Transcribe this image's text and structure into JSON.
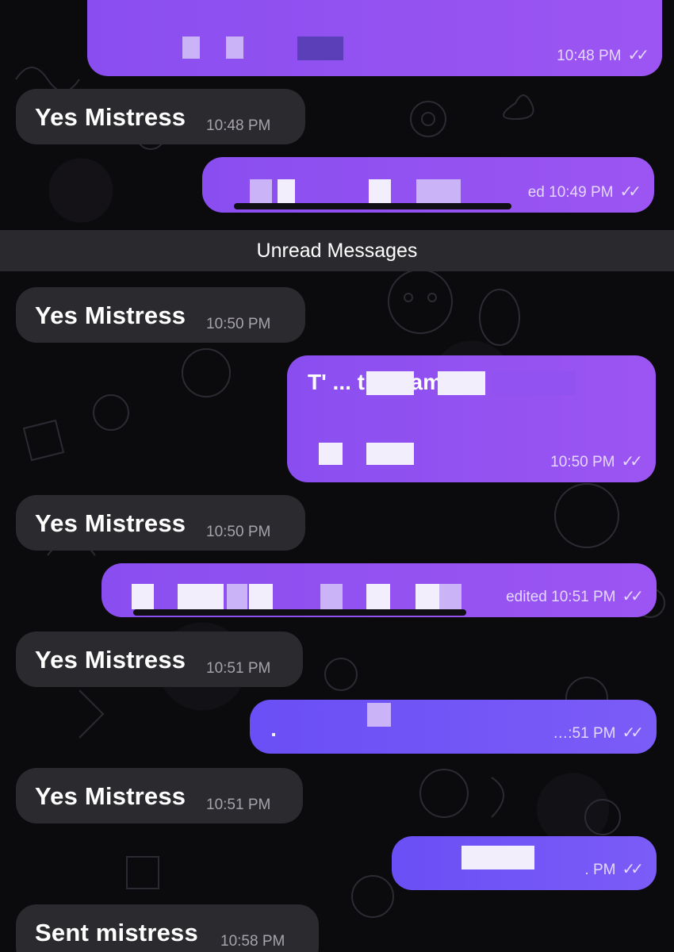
{
  "divider": {
    "label": "Unread Messages"
  },
  "messages": [
    {
      "direction": "out",
      "text": "",
      "meta": "10:48 PM"
    },
    {
      "direction": "in",
      "text": "Yes Mistress",
      "time": "10:48 PM"
    },
    {
      "direction": "out",
      "text": "",
      "meta": "ed 10:49 PM"
    },
    {
      "direction": "in",
      "text": "Yes Mistress",
      "time": "10:50 PM"
    },
    {
      "direction": "out",
      "text": "T' ... the name of",
      "meta": "10:50 PM"
    },
    {
      "direction": "in",
      "text": "Yes Mistress",
      "time": "10:50 PM"
    },
    {
      "direction": "out",
      "text": "",
      "meta": "edited 10:51 PM"
    },
    {
      "direction": "in",
      "text": "Yes Mistress",
      "time": "10:51 PM"
    },
    {
      "direction": "out",
      "text": "",
      "meta": "…:51 PM"
    },
    {
      "direction": "in",
      "text": "Yes Mistress",
      "time": "10:51 PM"
    },
    {
      "direction": "out",
      "text": "",
      "meta": ". PM"
    },
    {
      "direction": "in",
      "text": "Sent mistress",
      "time": "10:58 PM"
    }
  ],
  "colors": {
    "background": "#0b0b0d",
    "incoming_bubble": "#2b2a2e",
    "outgoing_bubble": "#9252f1",
    "outgoing_bubble_alt": "#6f52f6",
    "divider": "#2a2a2e"
  },
  "icons": {
    "read_receipt": "double-check-icon"
  }
}
